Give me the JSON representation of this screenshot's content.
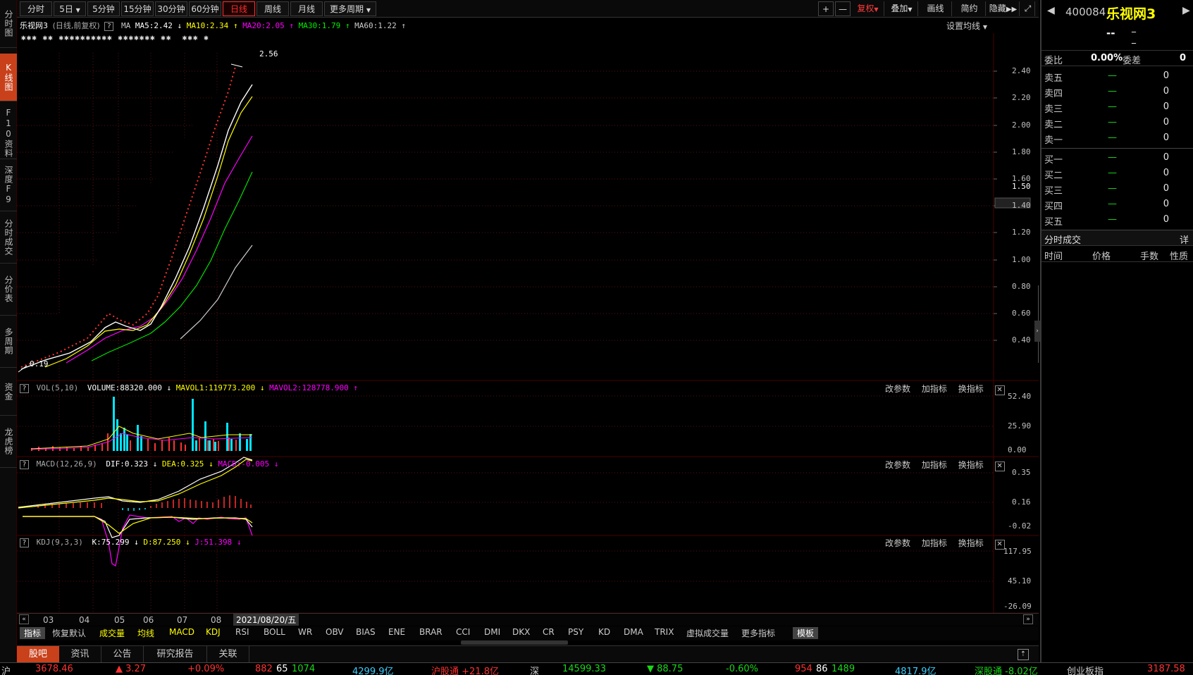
{
  "sidebar": {
    "items": [
      {
        "label": "分时图",
        "active": false
      },
      {
        "label": "K线图",
        "active": true
      },
      {
        "label": "F10资料",
        "active": false
      },
      {
        "label": "深度F9",
        "active": false
      },
      {
        "label": "分时成交",
        "active": false
      },
      {
        "label": "分价表",
        "active": false
      },
      {
        "label": "多周期",
        "active": false
      },
      {
        "label": "资金",
        "active": false
      },
      {
        "label": "龙虎榜",
        "active": false
      }
    ]
  },
  "toolbar": {
    "periods": [
      "分时",
      "5日",
      "5分钟",
      "15分钟",
      "30分钟",
      "60分钟",
      "日线",
      "周线",
      "月线",
      "更多周期"
    ],
    "active_period": "日线",
    "right": {
      "plus": "+",
      "minus": "—",
      "restore": "复权",
      "overlay": "叠加",
      "draw": "画线",
      "simple": "简约",
      "hide": "隐藏"
    }
  },
  "main": {
    "stock_name": "乐视网3",
    "mode": "(日线,前复权)",
    "ma_label": "MA",
    "ma5": "MA5:2.42",
    "ma10": "MA10:2.34",
    "ma20": "MA20:2.05",
    "ma30": "MA30:1.79",
    "ma60": "MA60:1.22",
    "settings": "设置均线",
    "high_label": "2.56",
    "low_label": "0.19",
    "price_marker": "1.50",
    "y_ticks": [
      "2.40",
      "2.20",
      "2.00",
      "1.80",
      "1.60",
      "1.40",
      "1.20",
      "1.00",
      "0.80",
      "0.60",
      "0.40"
    ]
  },
  "vol": {
    "name": "VOL(5,10)",
    "volume": "VOLUME:88320.000",
    "mavol1": "MAVOL1:119773.200",
    "mavol2": "MAVOL2:128778.900",
    "y_ticks": [
      "52.40",
      "25.90",
      "0.00"
    ]
  },
  "macd": {
    "name": "MACD(12,26,9)",
    "dif": "DIF:0.323",
    "dea": "DEA:0.325",
    "macd": "MACD:-0.005",
    "y_ticks": [
      "0.35",
      "0.16",
      "-0.02"
    ]
  },
  "kdj": {
    "name": "KDJ(9,3,3)",
    "k": "K:75.299",
    "d": "D:87.250",
    "j": "J:51.398",
    "y_ticks": [
      "117.95",
      "45.10",
      "-26.09"
    ]
  },
  "panel_links": {
    "params": "改参数",
    "add": "加指标",
    "change": "换指标"
  },
  "x_axis": {
    "labels": [
      "03",
      "04",
      "05",
      "06",
      "07",
      "08"
    ],
    "current_date": "2021/08/20/五"
  },
  "indicator_tabs": [
    "指标",
    "恢复默认",
    "成交量",
    "均线",
    "MACD",
    "KDJ",
    "RSI",
    "BOLL",
    "WR",
    "OBV",
    "BIAS",
    "ENE",
    "BRAR",
    "CCI",
    "DMI",
    "DKX",
    "CR",
    "PSY",
    "KD",
    "DMA",
    "TRIX",
    "虚拟成交量",
    "更多指标",
    "模板"
  ],
  "bottom_tabs": [
    "股吧",
    "资讯",
    "公告",
    "研究报告",
    "关联"
  ],
  "quote": {
    "code": "400084",
    "name": "乐视网3",
    "price": "--",
    "change": "_",
    "change2": "_",
    "wei_bi_label": "委比",
    "wei_bi": "0.00%",
    "wei_cha_label": "委差",
    "wei_cha": "0",
    "sell": [
      {
        "label": "卖五",
        "price": "—",
        "vol": "0"
      },
      {
        "label": "卖四",
        "price": "—",
        "vol": "0"
      },
      {
        "label": "卖三",
        "price": "—",
        "vol": "0"
      },
      {
        "label": "卖二",
        "price": "—",
        "vol": "0"
      },
      {
        "label": "卖一",
        "price": "—",
        "vol": "0"
      }
    ],
    "buy": [
      {
        "label": "买一",
        "price": "—",
        "vol": "0"
      },
      {
        "label": "买二",
        "price": "—",
        "vol": "0"
      },
      {
        "label": "买三",
        "price": "—",
        "vol": "0"
      },
      {
        "label": "买四",
        "price": "—",
        "vol": "0"
      },
      {
        "label": "买五",
        "price": "—",
        "vol": "0"
      }
    ],
    "trades_title": "分时成交",
    "trades_detail": "详",
    "trades_cols": [
      "时间",
      "价格",
      "手数",
      "性质"
    ]
  },
  "ticker": {
    "sh_label": "沪",
    "sh_index": "3678.46",
    "sh_change": "▲ 3.27",
    "sh_pct": "+0.09%",
    "sh_up": "882",
    "sh_flat": "65",
    "sh_down": "1074",
    "sh_amount": "4299.9亿",
    "hgt": "沪股通 +21.8亿",
    "sz_label": "深",
    "sz_index": "14599.33",
    "sz_change": "▼ 88.75",
    "sz_pct": "-0.60%",
    "sz_up": "954",
    "sz_flat": "86",
    "sz_down": "1489",
    "sz_amount": "4817.9亿",
    "sgt": "深股通 -8.02亿",
    "cyb_label": "创业板指",
    "cyb_index": "3187.58"
  },
  "colors": {
    "accent": "#c8411b",
    "up": "#ff3232",
    "down": "#19d819",
    "ma5": "#ffffff",
    "ma10": "#ffff00",
    "ma20": "#ff00ff",
    "ma30": "#00e000",
    "ma60": "#cccccc",
    "vol_bar": "#00e5ff"
  }
}
